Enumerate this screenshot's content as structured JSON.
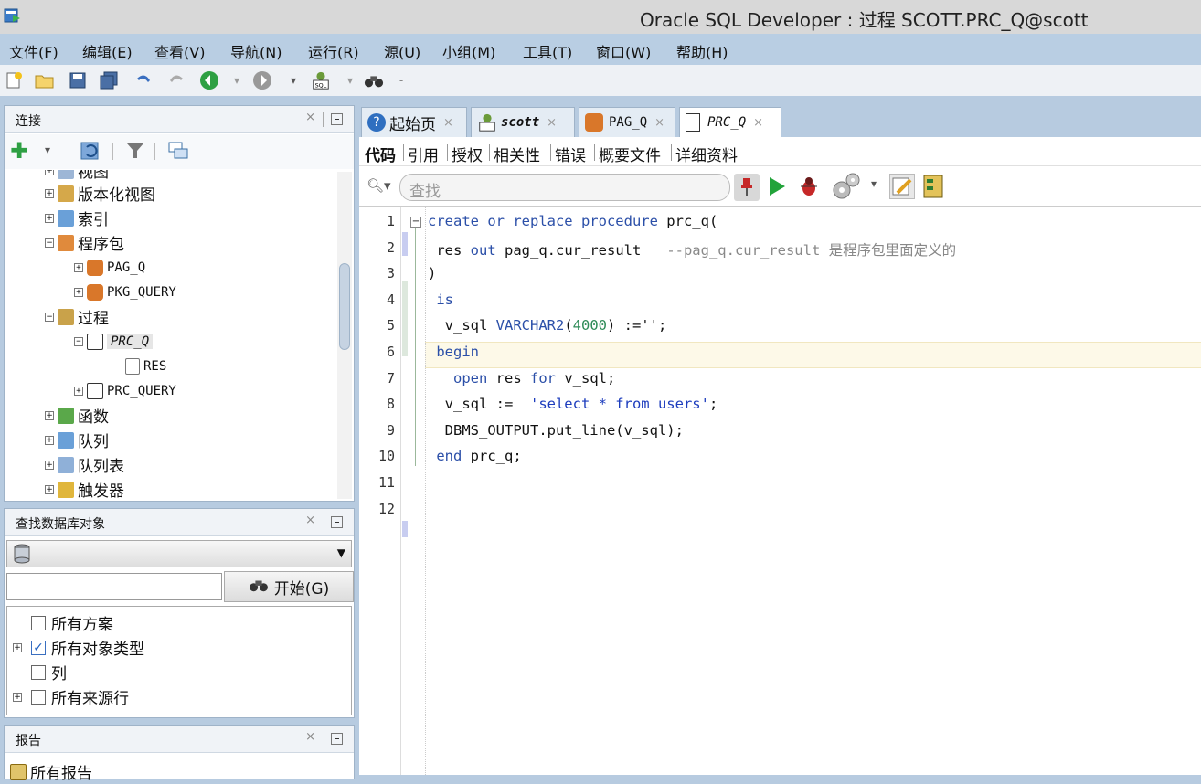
{
  "window": {
    "title": "Oracle SQL Developer : 过程 SCOTT.PRC_Q@scott"
  },
  "menu": [
    "文件(F)",
    "编辑(E)",
    "查看(V)",
    "导航(N)",
    "运行(R)",
    "源(U)",
    "小组(M)",
    "工具(T)",
    "窗口(W)",
    "帮助(H)"
  ],
  "connections_panel": {
    "title": "连接",
    "tree": [
      {
        "label": "视图",
        "level": 2,
        "expander": "+"
      },
      {
        "label": "版本化视图",
        "level": 2,
        "expander": "+"
      },
      {
        "label": "索引",
        "level": 2,
        "expander": "+"
      },
      {
        "label": "程序包",
        "level": 2,
        "expander": "-"
      },
      {
        "label": "PAG_Q",
        "level": 3,
        "expander": "+",
        "mono": true
      },
      {
        "label": "PKG_QUERY",
        "level": 3,
        "expander": "+",
        "mono": true
      },
      {
        "label": "过程",
        "level": 2,
        "expander": "-"
      },
      {
        "label": "PRC_Q",
        "level": 3,
        "expander": "-",
        "mono": true,
        "italic": true,
        "selected": true
      },
      {
        "label": "RES",
        "level": 4,
        "expander": "",
        "mono": true
      },
      {
        "label": "PRC_QUERY",
        "level": 3,
        "expander": "+",
        "mono": true
      },
      {
        "label": "函数",
        "level": 2,
        "expander": "+"
      },
      {
        "label": "队列",
        "level": 2,
        "expander": "+"
      },
      {
        "label": "队列表",
        "level": 2,
        "expander": "+"
      },
      {
        "label": "触发器",
        "level": 2,
        "expander": "+"
      }
    ]
  },
  "find_panel": {
    "title": "查找数据库对象",
    "search_value": "",
    "start_label": "开始(G)",
    "options": [
      {
        "label": "所有方案",
        "checked": false,
        "expander": ""
      },
      {
        "label": "所有对象类型",
        "checked": true,
        "expander": "+"
      },
      {
        "label": "列",
        "checked": false,
        "expander": ""
      },
      {
        "label": "所有来源行",
        "checked": false,
        "expander": "+"
      }
    ]
  },
  "reports_panel": {
    "title": "报告",
    "first_item": "所有报告"
  },
  "editor": {
    "tabs": [
      {
        "label": "起始页",
        "icon": "help-icon",
        "italic": false
      },
      {
        "label": "scott",
        "icon": "sql-connection-icon",
        "italic": true
      },
      {
        "label": "PAG_Q",
        "icon": "package-icon",
        "italic": false
      },
      {
        "label": "PRC_Q",
        "icon": "procedure-icon",
        "italic": true,
        "active": true
      }
    ],
    "subtabs": [
      "代码",
      "引用",
      "授权",
      "相关性",
      "错误",
      "概要文件",
      "详细资料"
    ],
    "search_placeholder": "查找",
    "line_numbers": [
      "1",
      "2",
      "3",
      "4",
      "5",
      "6",
      "7",
      "8",
      "9",
      "10",
      "11",
      "12"
    ],
    "code_lines": [
      [
        {
          "t": "create or replace procedure",
          "c": "kw"
        },
        {
          "t": " prc_q(",
          "c": ""
        }
      ],
      [
        {
          "t": " res ",
          "c": ""
        },
        {
          "t": "out",
          "c": "kw"
        },
        {
          "t": " pag_q.cur_result   ",
          "c": ""
        },
        {
          "t": "--pag_q.cur_result 是程序包里面定义的",
          "c": "cm"
        }
      ],
      [
        {
          "t": ")",
          "c": ""
        }
      ],
      [
        {
          "t": " is",
          "c": "kw"
        }
      ],
      [
        {
          "t": "  v_sql ",
          "c": ""
        },
        {
          "t": "VARCHAR2",
          "c": "kw"
        },
        {
          "t": "(",
          "c": ""
        },
        {
          "t": "4000",
          "c": "nm"
        },
        {
          "t": ") :='';",
          "c": ""
        }
      ],
      [
        {
          "t": " begin",
          "c": "kw"
        }
      ],
      [
        {
          "t": "   open",
          "c": "kw"
        },
        {
          "t": " res ",
          "c": ""
        },
        {
          "t": "for",
          "c": "kw"
        },
        {
          "t": " v_sql;",
          "c": ""
        }
      ],
      [
        {
          "t": "  v_sql :=  ",
          "c": ""
        },
        {
          "t": "'select * from users'",
          "c": "st"
        },
        {
          "t": ";",
          "c": ""
        }
      ],
      [
        {
          "t": "  DBMS_OUTPUT.put_line(v_sql);",
          "c": ""
        }
      ],
      [
        {
          "t": " end",
          "c": "kw"
        },
        {
          "t": " prc_q;",
          "c": ""
        }
      ],
      [],
      []
    ]
  }
}
